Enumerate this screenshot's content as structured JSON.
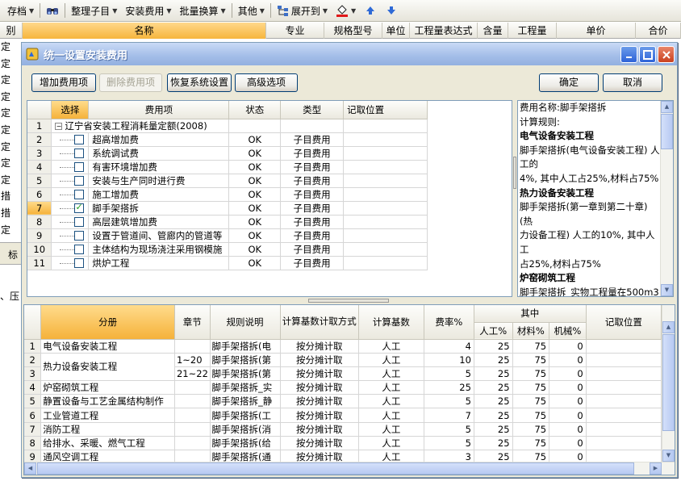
{
  "toolbar": {
    "items": [
      {
        "label": "存档",
        "dropdown": true
      },
      {
        "label": "整理子目",
        "dropdown": true
      },
      {
        "label": "安装费用",
        "dropdown": true
      },
      {
        "label": "批量换算",
        "dropdown": true
      },
      {
        "label": "其他",
        "dropdown": true
      },
      {
        "label": "展开到",
        "dropdown": true
      }
    ]
  },
  "background": {
    "headers": [
      "别",
      "名称",
      "专业",
      "规格型号",
      "单位",
      "工程量表达式",
      "含量",
      "工程量",
      "单价",
      "合价"
    ],
    "row_glyphs": [
      "定",
      "定",
      "定",
      "定",
      "定",
      "定",
      "定",
      "定",
      "定",
      "措",
      "措",
      "定"
    ],
    "strip_label": "标",
    "text2": "、压"
  },
  "dialog": {
    "title": "统一设置安装费用",
    "buttons": {
      "add": "增加费用项",
      "delete": "删除费用项",
      "restore": "恢复系统设置",
      "advanced": "高级选项",
      "ok": "确定",
      "cancel": "取消"
    },
    "top_table": {
      "headers": [
        "选择",
        "费用项",
        "状态",
        "类型",
        "记取位置"
      ],
      "rows": [
        {
          "n": "1",
          "name": "辽宁省安装工程消耗量定额(2008)",
          "status": "",
          "type": "",
          "checked": false,
          "root": true
        },
        {
          "n": "2",
          "name": "超高增加费",
          "status": "OK",
          "type": "子目费用",
          "checked": false
        },
        {
          "n": "3",
          "name": "系统调试费",
          "status": "OK",
          "type": "子目费用",
          "checked": false
        },
        {
          "n": "4",
          "name": "有害环境增加费",
          "status": "OK",
          "type": "子目费用",
          "checked": false
        },
        {
          "n": "5",
          "name": "安装与生产同时进行费",
          "status": "OK",
          "type": "子目费用",
          "checked": false
        },
        {
          "n": "6",
          "name": "施工增加费",
          "status": "OK",
          "type": "子目费用",
          "checked": false
        },
        {
          "n": "7",
          "name": "脚手架搭拆",
          "status": "OK",
          "type": "子目费用",
          "checked": true
        },
        {
          "n": "8",
          "name": "高层建筑增加费",
          "status": "OK",
          "type": "子目费用",
          "checked": false
        },
        {
          "n": "9",
          "name": "设置于管道间、管廊内的管道等",
          "status": "OK",
          "type": "子目费用",
          "checked": false
        },
        {
          "n": "10",
          "name": "主体结构为现场浇注采用钢模施",
          "status": "OK",
          "type": "子目费用",
          "checked": false
        },
        {
          "n": "11",
          "name": "烘炉工程",
          "status": "OK",
          "type": "子目费用",
          "checked": false
        }
      ]
    },
    "description": {
      "lines": [
        {
          "text": "费用名称:脚手架搭拆",
          "bold": false
        },
        {
          "text": "计算规则:",
          "bold": false
        },
        {
          "text": "电气设备安装工程",
          "bold": true
        },
        {
          "text": "脚手架搭拆(电气设备安装工程) 人工的",
          "bold": false
        },
        {
          "text": "4%, 其中人工占25%,材料占75%",
          "bold": false
        },
        {
          "text": "热力设备安装工程",
          "bold": true
        },
        {
          "text": "脚手架搭拆(第一章到第二十章)(热",
          "bold": false
        },
        {
          "text": "力设备工程) 人工的10%, 其中人工",
          "bold": false
        },
        {
          "text": "占25%,材料占75%",
          "bold": false
        },
        {
          "text": "炉窑砌筑工程",
          "bold": true
        },
        {
          "text": "脚手架搭拆_实物工程量在500m3以",
          "bold": false
        }
      ]
    },
    "bottom_table": {
      "headers": {
        "volume": "分册",
        "chapter": "章节",
        "rule": "规则说明",
        "calc_method": "计算基数计取方式",
        "base": "计算基数",
        "rate": "费率%",
        "of_which": "其中",
        "labor": "人工%",
        "material": "材料%",
        "machine": "机械%",
        "position": "记取位置"
      },
      "rows": [
        {
          "n": "1",
          "volume": "电气设备安装工程",
          "chapter": "",
          "rule": "脚手架搭拆(电",
          "method": "按分摊计取",
          "base": "人工",
          "rate": "4",
          "labor": "25",
          "material": "75",
          "machine": "0"
        },
        {
          "n": "2",
          "volume": "热力设备安装工程",
          "chapter": "1~20",
          "rule": "脚手架搭拆(第",
          "method": "按分摊计取",
          "base": "人工",
          "rate": "10",
          "labor": "25",
          "material": "75",
          "machine": "0"
        },
        {
          "n": "3",
          "volume": "",
          "chapter": "21~22",
          "rule": "脚手架搭拆(第",
          "method": "按分摊计取",
          "base": "人工",
          "rate": "5",
          "labor": "25",
          "material": "75",
          "machine": "0"
        },
        {
          "n": "4",
          "volume": "炉窑砌筑工程",
          "chapter": "",
          "rule": "脚手架搭拆_实",
          "method": "按分摊计取",
          "base": "人工",
          "rate": "25",
          "labor": "25",
          "material": "75",
          "machine": "0"
        },
        {
          "n": "5",
          "volume": "静置设备与工艺金属结构制作",
          "chapter": "",
          "rule": "脚手架搭拆_静",
          "method": "按分摊计取",
          "base": "人工",
          "rate": "5",
          "labor": "25",
          "material": "75",
          "machine": "0"
        },
        {
          "n": "6",
          "volume": "工业管道工程",
          "chapter": "",
          "rule": "脚手架搭拆(工",
          "method": "按分摊计取",
          "base": "人工",
          "rate": "7",
          "labor": "25",
          "material": "75",
          "machine": "0"
        },
        {
          "n": "7",
          "volume": "消防工程",
          "chapter": "",
          "rule": "脚手架搭拆(消",
          "method": "按分摊计取",
          "base": "人工",
          "rate": "5",
          "labor": "25",
          "material": "75",
          "machine": "0"
        },
        {
          "n": "8",
          "volume": "给排水、采暖、燃气工程",
          "chapter": "",
          "rule": "脚手架搭拆(给",
          "method": "按分摊计取",
          "base": "人工",
          "rate": "5",
          "labor": "25",
          "material": "75",
          "machine": "0"
        },
        {
          "n": "9",
          "volume": "通风空调工程",
          "chapter": "",
          "rule": "脚手架搭拆(通",
          "method": "按分摊计取",
          "base": "人工",
          "rate": "3",
          "labor": "25",
          "material": "75",
          "machine": "0"
        }
      ]
    }
  }
}
